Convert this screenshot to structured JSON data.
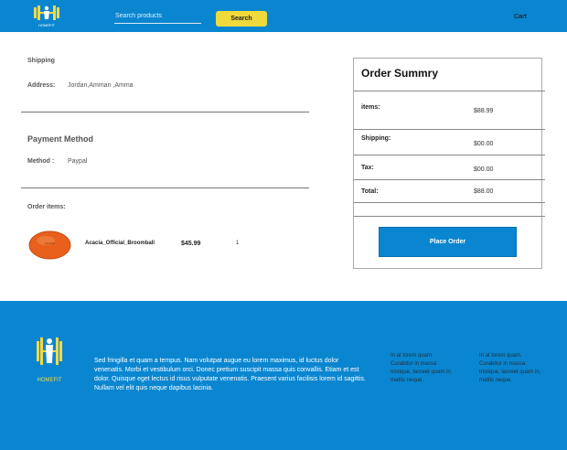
{
  "header": {
    "brand": "HOMEFIT",
    "search_placeholder": "Search products",
    "search_button": "Search",
    "cart_label": "Cart"
  },
  "shipping": {
    "heading": "Shipping",
    "address_label": "Address:",
    "address_value": "Jordan,Amman ,Amma"
  },
  "payment": {
    "heading": "Payment Method",
    "method_label": "Method :",
    "method_value": "Paypal"
  },
  "order_items": {
    "heading": "Order items:",
    "items": [
      {
        "name": "Acacia_Official_Broomball",
        "price": "$45.99",
        "quantity": "1"
      }
    ]
  },
  "summary": {
    "title": "Order Summry",
    "items_label": "items:",
    "items_value": "$88.99",
    "shipping_label": "Shipping:",
    "shipping_value": "$00.00",
    "tax_label": "Tax:",
    "tax_value": "$00.00",
    "total_label": "Total:",
    "total_value": "$88.00",
    "place_order_button": "Place Order"
  },
  "footer": {
    "brand": "HOMEFIT",
    "description": "Sed fringilla et quam a tempus. Nam volutpat augue eu lorem maximus, id luctus dolor venenatis. Morbi et vestibulum orci. Donec pretium suscipit massa quis convallis. Etiam et est dolor. Quisque eget lectus id risus vulputate venenatis. Praesent varius facilisis lorem id sagittis. Nullam vel elit quis neque dapibus lacinia.",
    "col1": "In at lorem quam. Curabitur in massa tristique, laoreet quam in, mattis neque.",
    "col2": "In at lorem quam. Curabitur in massa tristique, laoreet quam in, mattis neque."
  },
  "colors": {
    "brand_blue": "#0a86d0",
    "accent_yellow": "#f0d93a",
    "logo_yellow": "#f2d94a",
    "ball_orange": "#e8601c"
  }
}
